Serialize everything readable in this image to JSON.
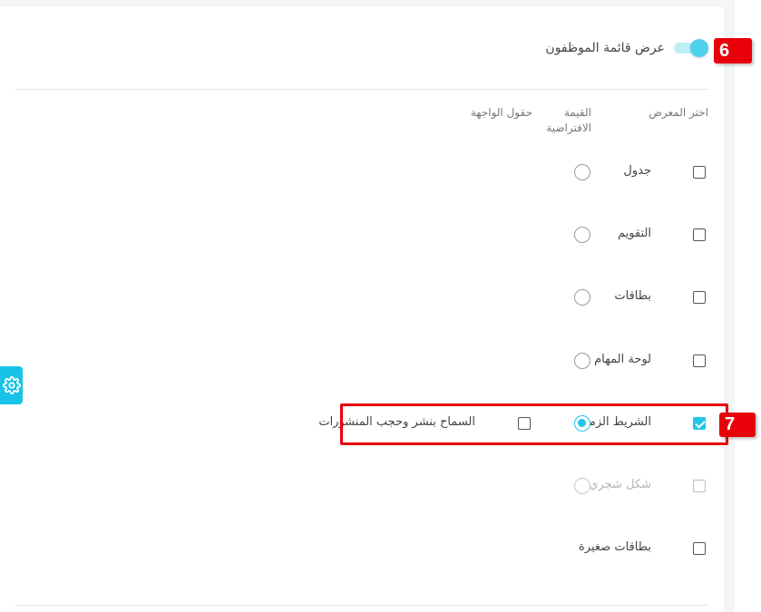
{
  "toggle": {
    "label": "عرض قائمة الموظفون",
    "on": true
  },
  "annotations": [
    {
      "number": "6"
    },
    {
      "number": "7"
    }
  ],
  "columns": {
    "view": "اختر المعرض",
    "default_line1": "القيمة",
    "default_line2": "الافتراضية",
    "fields": "حقول الواجهة"
  },
  "rows": [
    {
      "label": "جدول",
      "checked": false,
      "disabled": false,
      "default": false
    },
    {
      "label": "التقويم",
      "checked": false,
      "disabled": false,
      "default": false
    },
    {
      "label": "بطاقات",
      "checked": false,
      "disabled": false,
      "default": false
    },
    {
      "label": "لوحة المهام",
      "checked": false,
      "disabled": false,
      "default": false
    },
    {
      "label": "الشريط الزمني",
      "checked": true,
      "disabled": false,
      "default": true,
      "field": {
        "label": "السماح بنشر وحجب المنشورات",
        "checked": false
      }
    },
    {
      "label": "شكل شجري",
      "checked": false,
      "disabled": true,
      "default": false
    },
    {
      "label": "بطاقات صغيرة",
      "checked": false,
      "disabled": false,
      "default": null
    }
  ],
  "colors": {
    "accent": "#20c6ea",
    "annotation": "#e8000b"
  },
  "icons": {
    "settings_tab": "gear-icon"
  }
}
